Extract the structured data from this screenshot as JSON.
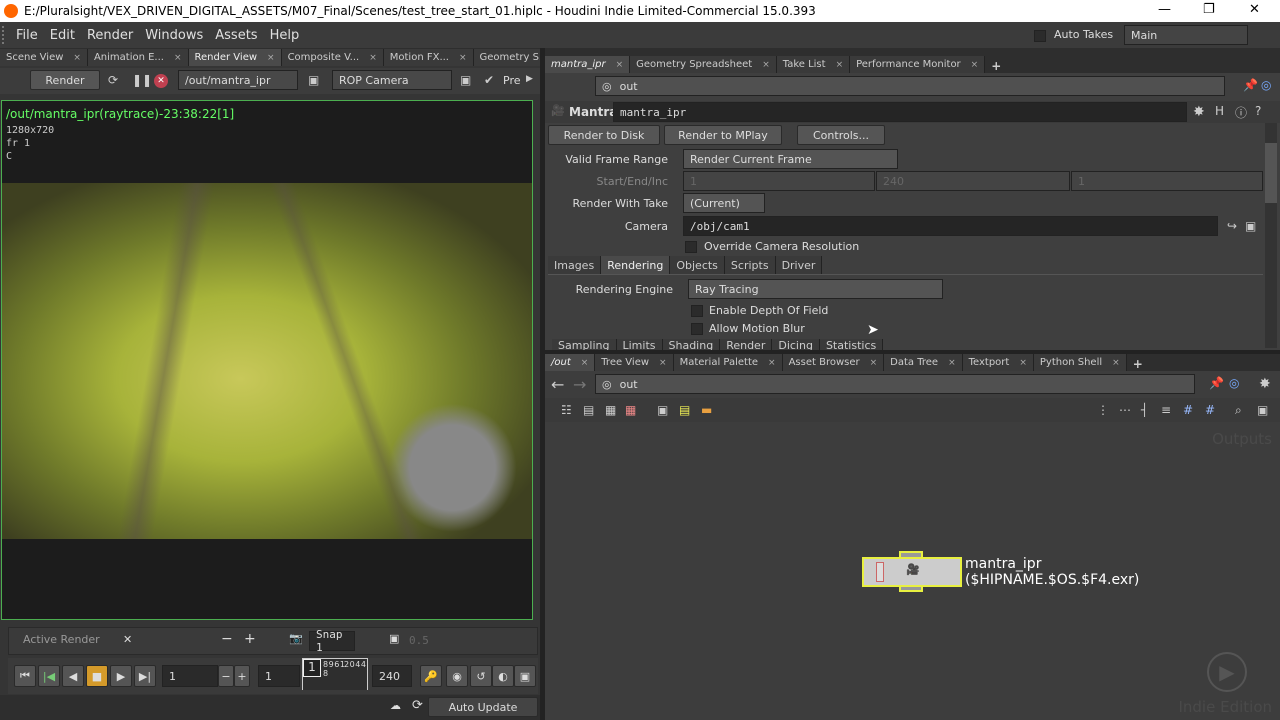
{
  "window": {
    "title": "E:/Pluralsight/VEX_DRIVEN_DIGITAL_ASSETS/M07_Final/Scenes/test_tree_start_01.hiplc - Houdini Indie Limited-Commercial 15.0.393"
  },
  "menu": [
    "File",
    "Edit",
    "Render",
    "Windows",
    "Assets",
    "Help"
  ],
  "auto_takes": "Auto Takes",
  "desktop": "Main",
  "left": {
    "tabs": [
      "Scene View",
      "Animation E...",
      "Render View",
      "Composite V...",
      "Motion FX...",
      "Geometry S..."
    ],
    "render_btn": "Render",
    "rop": "/out/mantra_ipr",
    "camera": "ROP Camera",
    "preview": "Pre",
    "info": {
      "title": "/out/mantra_ipr(raytrace)-23:38:22[1]",
      "res": "1280x720",
      "frame": "fr 1",
      "channel": "C"
    },
    "active_render": "Active Render",
    "snap": "Snap  1",
    "gamma": "0.5",
    "frame": "1",
    "start": "1",
    "end": "240",
    "timeline_frame": "1",
    "timeline_ticks": "8 9 6 12 0 4 4 8",
    "auto_update": "Auto Update"
  },
  "params": {
    "tabs": [
      "mantra_ipr",
      "Geometry Spreadsheet",
      "Take List",
      "Performance Monitor"
    ],
    "path": "out",
    "node_type": "Mantra",
    "node_name": "mantra_ipr",
    "buttons": [
      "Render to Disk",
      "Render to MPlay",
      "Controls..."
    ],
    "valid_frame_range_label": "Valid Frame Range",
    "valid_frame_range": "Render Current Frame",
    "start_end_inc_label": "Start/End/Inc",
    "start": "1",
    "end": "240",
    "inc": "1",
    "take_label": "Render With Take",
    "take": "(Current)",
    "camera_label": "Camera",
    "camera": "/obj/cam1",
    "override_res": "Override Camera Resolution",
    "folder_tabs": [
      "Images",
      "Rendering",
      "Objects",
      "Scripts",
      "Driver"
    ],
    "engine_label": "Rendering Engine",
    "engine": "Ray Tracing",
    "dof": "Enable Depth Of Field",
    "motion_blur": "Allow Motion Blur",
    "sub_tabs": [
      "Sampling",
      "Limits",
      "Shading",
      "Render",
      "Dicing",
      "Statistics"
    ]
  },
  "network": {
    "tabs": [
      "/out",
      "Tree View",
      "Material Palette",
      "Asset Browser",
      "Data Tree",
      "Textport",
      "Python Shell"
    ],
    "path": "out",
    "context_label": "Outputs",
    "edition": "Indie Edition",
    "node": {
      "name": "mantra_ipr",
      "output": "($HIPNAME.$OS.$F4.exr)"
    }
  }
}
